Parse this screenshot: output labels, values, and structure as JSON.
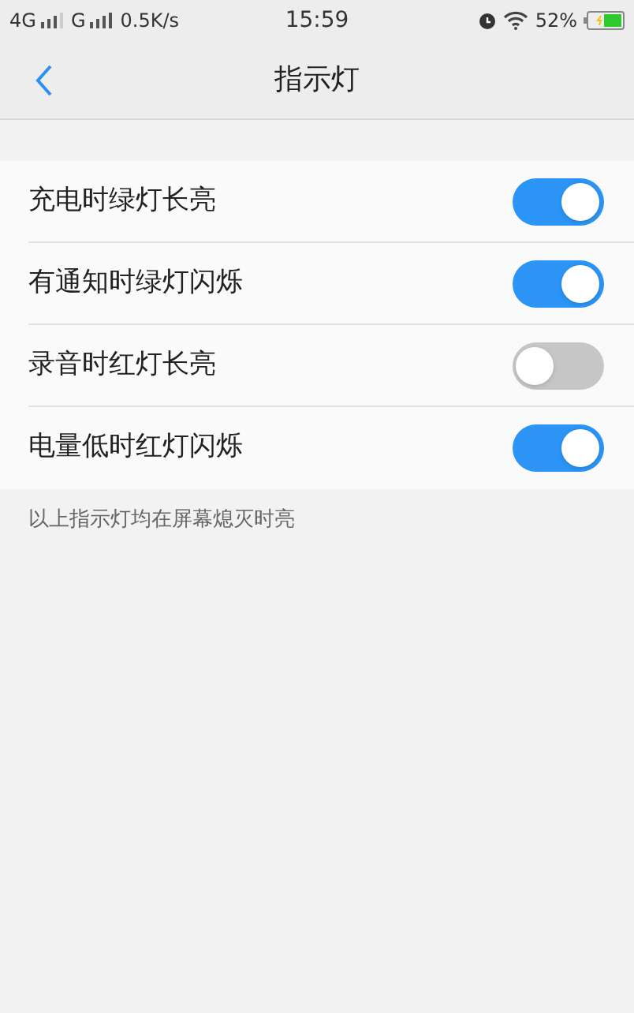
{
  "status_bar": {
    "network_1": "4G",
    "network_2": "G",
    "speed": "0.5K/s",
    "time": "15:59",
    "battery": "52%"
  },
  "header": {
    "title": "指示灯"
  },
  "settings": [
    {
      "label": "充电时绿灯长亮",
      "on": true
    },
    {
      "label": "有通知时绿灯闪烁",
      "on": true
    },
    {
      "label": "录音时红灯长亮",
      "on": false
    },
    {
      "label": "电量低时红灯闪烁",
      "on": true
    }
  ],
  "footnote": "以上指示灯均在屏幕熄灭时亮"
}
